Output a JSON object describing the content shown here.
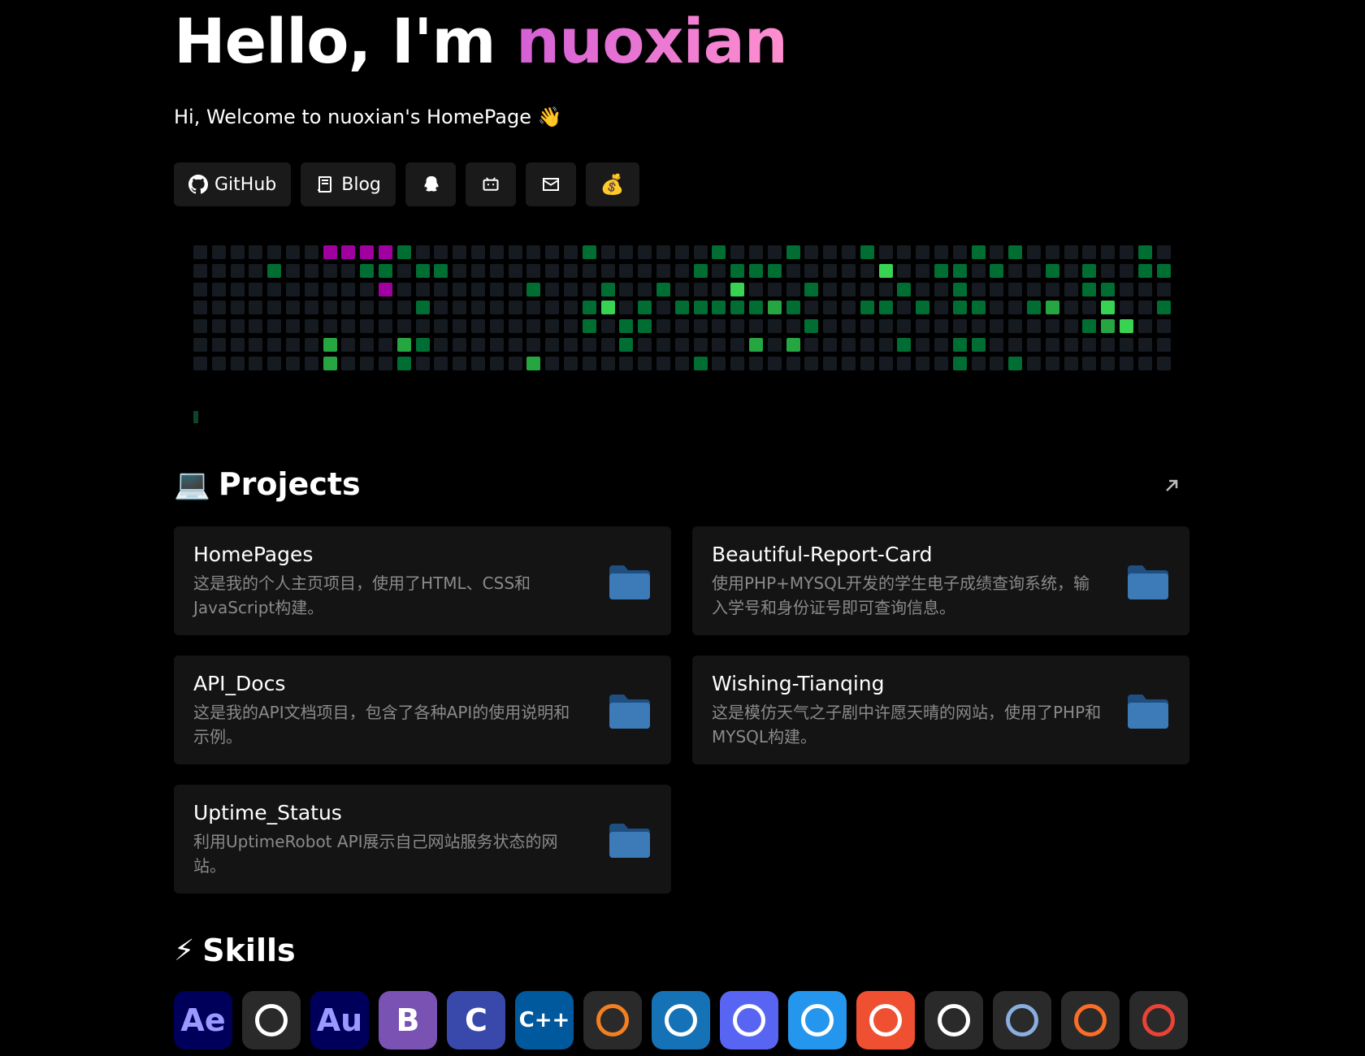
{
  "hero": {
    "greeting": "Hello, I'm ",
    "name": "nuoxian",
    "subtitle": "Hi, Welcome to nuoxian's HomePage 👋"
  },
  "links": [
    {
      "label": "GitHub",
      "icon": "github-icon"
    },
    {
      "label": "Blog",
      "icon": "book-icon"
    },
    {
      "label": "",
      "icon": "qq-icon"
    },
    {
      "label": "",
      "icon": "bilibili-icon"
    },
    {
      "label": "",
      "icon": "mail-icon"
    },
    {
      "label": "💰",
      "icon": "money-bag-icon"
    }
  ],
  "contrib_colors": {
    "0": "#161b22",
    "1": "#0e4429",
    "2": "#006d32",
    "3": "#26a641",
    "4": "#39d353",
    "p": "#a0009f"
  },
  "contrib_weeks": [
    "0000000",
    "0000000",
    "0000000",
    "0000000",
    "0200000",
    "0000000",
    "0000000",
    "p000033",
    "p000000",
    "p20000",
    "p2p00000",
    "2000032",
    "0202020",
    "0200000",
    "0000000",
    "0000000",
    "0000000",
    "0000000",
    "0020003",
    "0000000",
    "0000000",
    "2002200",
    "0024000",
    "0000220",
    "0002200",
    "0020000",
    "0002000",
    "0202002",
    "2002000",
    "0242000",
    "0202030",
    "0203000",
    "2002030",
    "0020200",
    "0000000",
    "0000000",
    "2002000",
    "0402000",
    "0020020",
    "0002000",
    "0200000",
    "0222022",
    "2002020",
    "0200000",
    "2000002",
    "0002000",
    "0203000",
    "0000000",
    "0220200",
    "0024300",
    "0000400",
    "2200000",
    "0202000"
  ],
  "projects": {
    "title": "Projects",
    "emoji": "💻",
    "items": [
      {
        "name": "HomePages",
        "desc": "这是我的个人主页项目，使用了HTML、CSS和JavaScript构建。"
      },
      {
        "name": "Beautiful-Report-Card",
        "desc": "使用PHP+MYSQL开发的学生电子成绩查询系统，输入学号和身份证号即可查询信息。"
      },
      {
        "name": "API_Docs",
        "desc": "这是我的API文档项目，包含了各种API的使用说明和示例。"
      },
      {
        "name": "Wishing-Tianqing",
        "desc": "这是模仿天气之子剧中许愿天晴的网站，使用了PHP和MYSQL构建。"
      },
      {
        "name": "Uptime_Status",
        "desc": "利用UptimeRobot API展示自己网站服务状态的网站。"
      }
    ]
  },
  "skills": {
    "title": "Skills",
    "emoji": "⚡",
    "items": [
      {
        "label": "Ae",
        "icon": "after-effects-icon",
        "bg": "#00005b",
        "fg": "#9999ff"
      },
      {
        "label": "",
        "icon": "apple-icon",
        "bg": "#2a2a2a",
        "fg": "#fff"
      },
      {
        "label": "Au",
        "icon": "audition-icon",
        "bg": "#00005b",
        "fg": "#9999ff"
      },
      {
        "label": "B",
        "icon": "bootstrap-icon",
        "bg": "#7952b3",
        "fg": "#fff"
      },
      {
        "label": "C",
        "icon": "c-language-icon",
        "bg": "#3949ab",
        "fg": "#fff"
      },
      {
        "label": "C++",
        "icon": "cpp-icon",
        "bg": "#00599c",
        "fg": "#fff"
      },
      {
        "label": "",
        "icon": "cloudflare-icon",
        "bg": "#2a2a2a",
        "fg": "#f38020"
      },
      {
        "label": "",
        "icon": "css3-icon",
        "bg": "#1572b6",
        "fg": "#fff"
      },
      {
        "label": "",
        "icon": "discord-icon",
        "bg": "#5865f2",
        "fg": "#fff"
      },
      {
        "label": "",
        "icon": "docker-icon",
        "bg": "#2496ed",
        "fg": "#fff"
      },
      {
        "label": "",
        "icon": "git-icon",
        "bg": "#f05032",
        "fg": "#fff"
      },
      {
        "label": "",
        "icon": "github-icon",
        "bg": "#2a2a2a",
        "fg": "#fff"
      },
      {
        "label": "",
        "icon": "github-actions-icon",
        "bg": "#2a2a2a",
        "fg": "#8aaee0"
      },
      {
        "label": "",
        "icon": "gitlab-icon",
        "bg": "#2a2a2a",
        "fg": "#fc6d26"
      },
      {
        "label": "",
        "icon": "gmail-icon",
        "bg": "#2a2a2a",
        "fg": "#ea4335"
      }
    ]
  }
}
